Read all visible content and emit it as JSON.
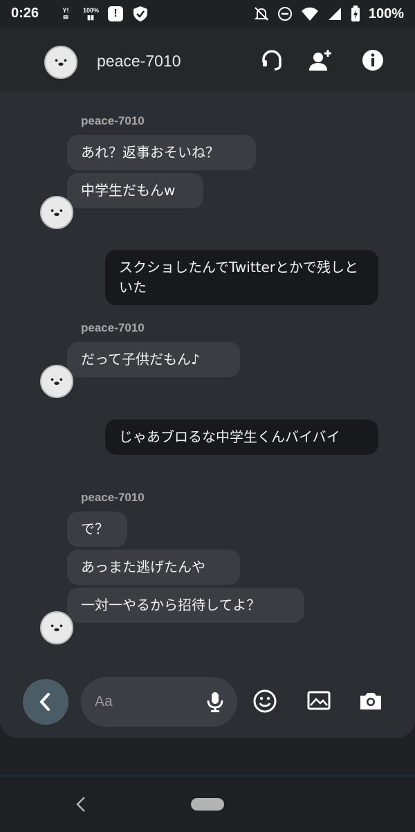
{
  "status_bar": {
    "time": "0:26",
    "left_icons": [
      "yahoo-mail-icon",
      "battery-saver-icon",
      "alert-icon",
      "shield-check-icon"
    ],
    "yahoo_text": "Y!",
    "percent_small": "100%",
    "right_icons": [
      "bell-off-icon",
      "do-not-disturb-icon",
      "wifi-icon",
      "signal-icon",
      "battery-charging-icon"
    ],
    "battery": "100%"
  },
  "header": {
    "contact_name": "peace-7010",
    "icons": [
      "headset-icon",
      "add-person-icon",
      "info-icon"
    ]
  },
  "messages": [
    {
      "type": "sender",
      "text": "peace-7010"
    },
    {
      "type": "in",
      "text": "あれ？返事おそいね？"
    },
    {
      "type": "in",
      "text": "中学生だもんw"
    },
    {
      "type": "out",
      "text": "スクショしたんでTwitterとかで残しといた"
    },
    {
      "type": "sender",
      "text": "peace-7010"
    },
    {
      "type": "in",
      "text": "だって子供だもん♪"
    },
    {
      "type": "out",
      "text": "じゃあブロるな中学生くんバイバイ"
    },
    {
      "type": "sender",
      "text": "peace-7010"
    },
    {
      "type": "in",
      "text": "で？"
    },
    {
      "type": "in",
      "text": "あっまた逃げたんや"
    },
    {
      "type": "in",
      "text": "一対一やるから招待してよ？"
    }
  ],
  "composer": {
    "placeholder": "Aa",
    "icons": [
      "chevron-left-icon",
      "mic-icon",
      "emoji-icon",
      "gallery-icon",
      "camera-icon"
    ]
  },
  "colors": {
    "background": "#202124",
    "panel": "#2b2e33",
    "incoming_bubble": "#3a3d42",
    "outgoing_bubble": "#17191c",
    "accent": "#4a5d66"
  }
}
